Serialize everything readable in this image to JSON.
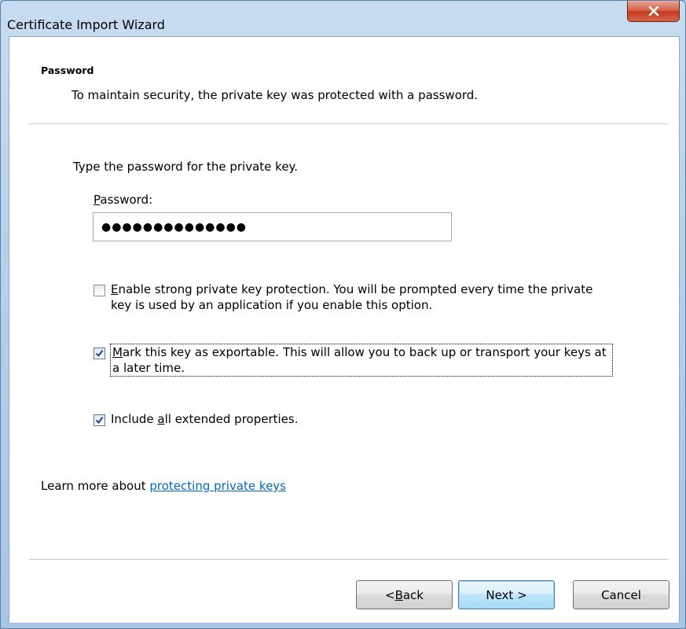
{
  "window": {
    "title": "Certificate Import Wizard",
    "close_icon": "close-icon"
  },
  "header": {
    "title": "Password",
    "description": "To maintain security, the private key was protected with a password."
  },
  "body": {
    "instruction": "Type the password for the private key.",
    "password_label_accel": "P",
    "password_label_rest": "assword:",
    "password_value": "●●●●●●●●●●●●●●"
  },
  "options": [
    {
      "accel": "E",
      "text": "nable strong private key protection. You will be prompted every time the private key is used by an application if you enable this option.",
      "checked": false
    },
    {
      "accel": "M",
      "text": "ark this key as exportable. This will allow you to back up or transport your keys at a later time.",
      "checked": true
    },
    {
      "pre": "Include ",
      "accel": "a",
      "text": "ll extended properties.",
      "checked": true
    }
  ],
  "learn_more": {
    "prefix": "Learn more about ",
    "link_text": "protecting private keys"
  },
  "buttons": {
    "back_pre": "< ",
    "back_accel": "B",
    "back_rest": "ack",
    "next": "Next >",
    "cancel": "Cancel"
  },
  "colors": {
    "link": "#0066cc",
    "close_button": "#c23a20",
    "frame": "#b7d0ea"
  }
}
